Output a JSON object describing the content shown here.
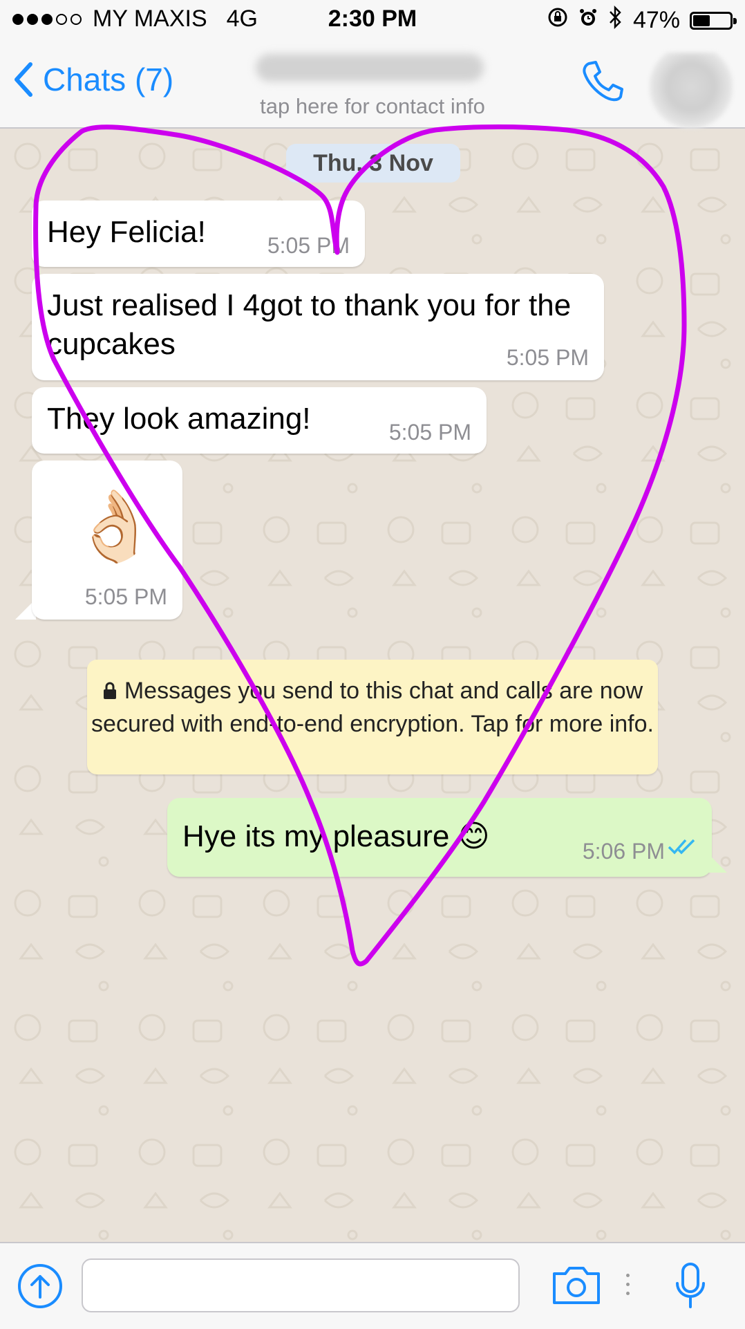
{
  "status_bar": {
    "carrier": "MY MAXIS",
    "network": "4G",
    "time": "2:30 PM",
    "battery": "47%",
    "battery_level": 0.47,
    "icons": [
      "rotation-lock-icon",
      "alarm-icon",
      "bluetooth-icon",
      "battery-icon"
    ]
  },
  "nav": {
    "back_label": "Chats (7)",
    "contact_subtitle": "tap here for contact info",
    "call_icon": "phone-icon",
    "accent": "#1a8cff"
  },
  "chat": {
    "date": "Thu, 3 Nov",
    "messages": [
      {
        "direction": "in",
        "text": "Hey Felicia!",
        "time": "5:05 PM"
      },
      {
        "direction": "in",
        "text": "Just realised I 4got to thank you for the cupcakes",
        "time": "5:05 PM"
      },
      {
        "direction": "in",
        "text": "They look amazing!",
        "time": "5:05 PM"
      },
      {
        "direction": "in",
        "text": "👌🏻",
        "time": "5:05 PM"
      },
      {
        "direction": "out",
        "text": "Hye its my pleasure 😊",
        "time": "5:06 PM",
        "status": "read"
      }
    ],
    "encryption_notice": "Messages you send to this chat and calls are now secured with end-to-end encryption. Tap for more info."
  },
  "input_bar": {
    "placeholder": "",
    "icons": [
      "upload-icon",
      "camera-icon",
      "microphone-icon"
    ]
  },
  "colors": {
    "incoming": "#ffffff",
    "outgoing": "#dcf8c6",
    "notice": "#fdf4c5",
    "read_ticks": "#34b7f1",
    "drawing": "#cc00ee"
  }
}
